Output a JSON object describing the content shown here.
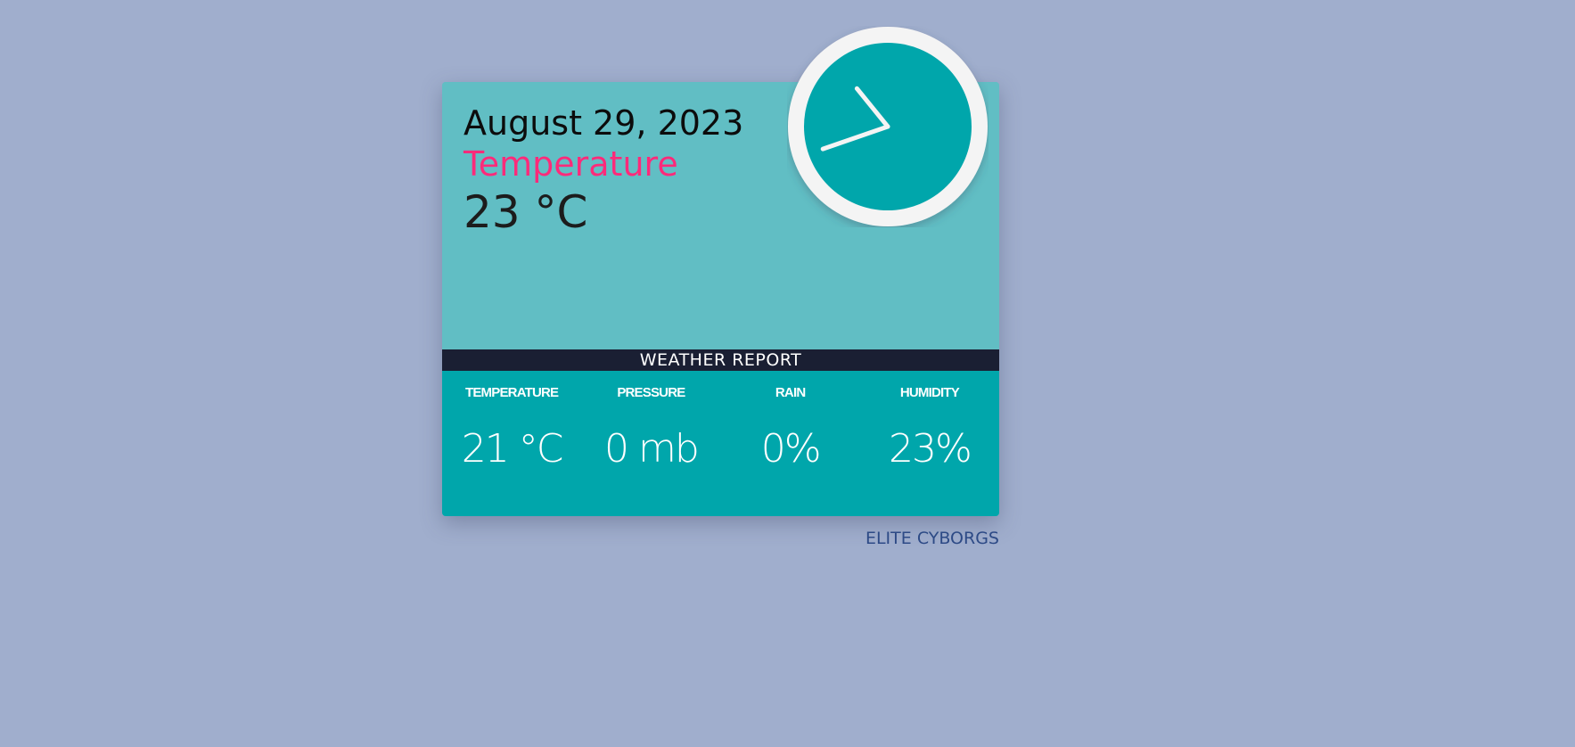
{
  "header": {
    "date": "August 29, 2023",
    "temperature_label": "Temperature",
    "temperature_value": "23 °C"
  },
  "clock": {
    "icon": "analog-clock-icon",
    "hour_angle_deg": 251,
    "minute_angle_deg": 321
  },
  "banner": {
    "title": "WEATHER REPORT"
  },
  "stats": [
    {
      "label": "TEMPERATURE",
      "value": "21 °C"
    },
    {
      "label": "PRESSURE",
      "value": "0 mb"
    },
    {
      "label": "RAIN",
      "value": "0%"
    },
    {
      "label": "HUMIDITY",
      "value": "23%"
    }
  ],
  "footer": {
    "credit": "ELITE CYBORGS"
  },
  "colors": {
    "background": "#a0aecd",
    "card_top": "#61bec4",
    "card_bottom": "#00a6ab",
    "banner": "#1a1f33",
    "accent_pink": "#ff2a7a",
    "footer_text": "#2d4a86"
  }
}
